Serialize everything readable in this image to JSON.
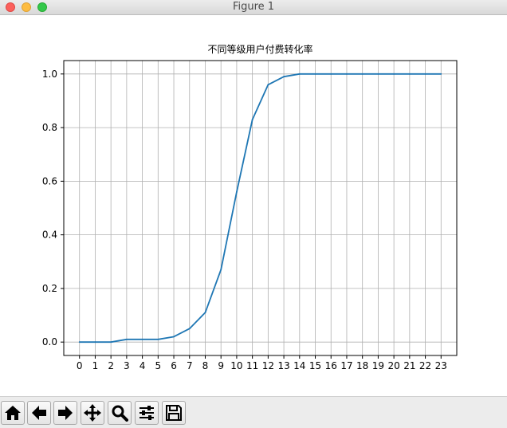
{
  "window": {
    "title": "Figure 1"
  },
  "toolbar": {
    "buttons": [
      {
        "name": "home-button",
        "icon": "home-icon"
      },
      {
        "name": "back-button",
        "icon": "arrow-left-icon"
      },
      {
        "name": "forward-button",
        "icon": "arrow-right-icon"
      },
      {
        "name": "pan-button",
        "icon": "move-icon"
      },
      {
        "name": "zoom-button",
        "icon": "magnifier-icon"
      },
      {
        "name": "configure-subplots-button",
        "icon": "sliders-icon"
      },
      {
        "name": "save-button",
        "icon": "floppy-disk-icon"
      }
    ]
  },
  "chart_data": {
    "type": "line",
    "title": "不同等级用户付费转化率",
    "xlabel": "",
    "ylabel": "",
    "x": [
      0,
      1,
      2,
      3,
      4,
      5,
      6,
      7,
      8,
      9,
      10,
      11,
      12,
      13,
      14,
      15,
      16,
      17,
      18,
      19,
      20,
      21,
      22,
      23
    ],
    "series": [
      {
        "values": [
          0.0,
          0.0,
          0.0,
          0.01,
          0.01,
          0.01,
          0.02,
          0.05,
          0.11,
          0.27,
          0.56,
          0.83,
          0.96,
          0.99,
          1.0,
          1.0,
          1.0,
          1.0,
          1.0,
          1.0,
          1.0,
          1.0,
          1.0,
          1.0
        ],
        "color": "#1f77b4"
      }
    ],
    "xticks": [
      "0",
      "1",
      "2",
      "3",
      "4",
      "5",
      "6",
      "7",
      "8",
      "9",
      "10",
      "11",
      "12",
      "13",
      "14",
      "15",
      "16",
      "17",
      "18",
      "19",
      "20",
      "21",
      "22",
      "23"
    ],
    "yticks": [
      "0.0",
      "0.2",
      "0.4",
      "0.6",
      "0.8",
      "1.0"
    ],
    "ylim": [
      -0.05,
      1.05
    ],
    "grid": true
  }
}
